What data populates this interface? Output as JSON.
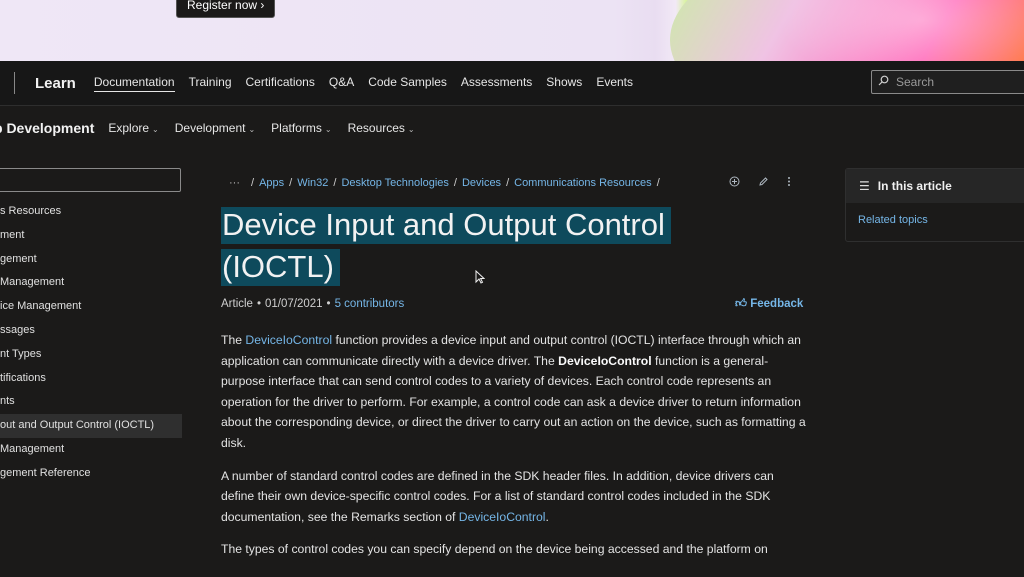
{
  "banner": {
    "register_label": "Register now",
    "register_chevron": "›"
  },
  "topnav": {
    "brand": "Learn",
    "items": [
      "Documentation",
      "Training",
      "Certifications",
      "Q&A",
      "Code Samples",
      "Assessments",
      "Shows",
      "Events"
    ],
    "search_placeholder": "Search"
  },
  "subnav": {
    "title": "p Development",
    "menus": [
      "Explore",
      "Development",
      "Platforms",
      "Resources"
    ]
  },
  "sidebar": {
    "items": [
      "s Resources",
      "ment",
      "gement",
      "Management",
      "ice Management",
      "ssages",
      "nt Types",
      "tifications",
      "nts",
      "out and Output Control (IOCTL)",
      "Management",
      "gement Reference"
    ],
    "active_index": 9
  },
  "breadcrumb": {
    "ellipsis": "···",
    "items": [
      "Apps",
      "Win32",
      "Desktop Technologies",
      "Devices",
      "Communications Resources"
    ]
  },
  "article": {
    "title_line1": "Device Input and Output Control",
    "title_line2": "(IOCTL)",
    "type": "Article",
    "date": "01/07/2021",
    "contributors": "5 contributors",
    "feedback": "Feedback",
    "p1": {
      "link": "DeviceIoControl",
      "t1": " function provides a device input and output control (IOCTL) interface through which an application can communicate directly with a device driver. The ",
      "bold": "DeviceIoControl",
      "t2": " function is a general-purpose interface that can send control codes to a variety of devices. Each control code represents an operation for the driver to perform. For example, a control code can ask a device driver to return information about the corresponding device, or direct the driver to carry out an action on the device, such as formatting a disk.",
      "lead": "The "
    },
    "p2": {
      "t1": "A number of standard control codes are defined in the SDK header files. In addition, device drivers can define their own device-specific control codes. For a list of standard control codes included in the SDK documentation, see the Remarks section of ",
      "link": "DeviceIoControl",
      "t2": "."
    },
    "p3": "The types of control codes you can specify depend on the device being accessed and the platform on"
  },
  "toc_panel": {
    "heading": "In this article",
    "links": [
      "Related topics"
    ]
  },
  "colors": {
    "accent_link": "#75b6e7",
    "title_highlight": "#0e4a5c",
    "background": "#1b1a19"
  }
}
